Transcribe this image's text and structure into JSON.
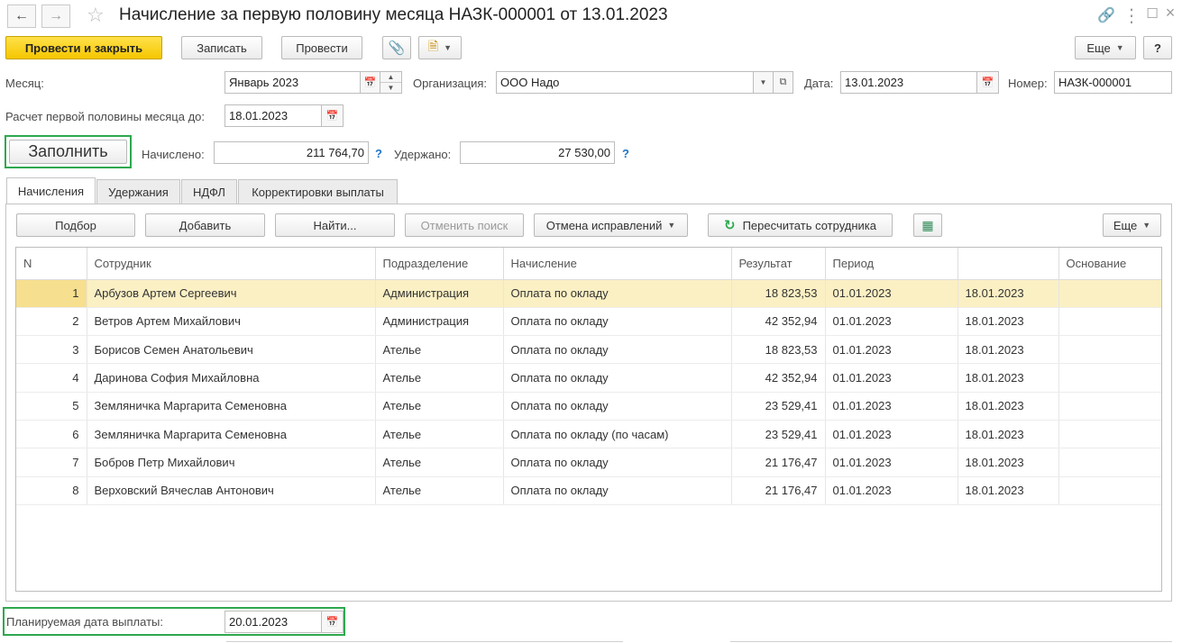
{
  "window": {
    "title": "Начисление за первую половину месяца НАЗК-000001 от 13.01.2023"
  },
  "toolbar": {
    "post_close": "Провести и закрыть",
    "save": "Записать",
    "post": "Провести",
    "more": "Еще",
    "help": "?"
  },
  "header": {
    "month_label": "Месяц:",
    "month_value": "Январь 2023",
    "org_label": "Организация:",
    "org_value": "ООО Надо",
    "date_label": "Дата:",
    "date_value": "13.01.2023",
    "number_label": "Номер:",
    "number_value": "НАЗК-000001",
    "calc_label": "Расчет первой половины месяца до:",
    "calc_value": "18.01.2023",
    "fill_button": "Заполнить",
    "accrued_label": "Начислено:",
    "accrued_value": "211 764,70",
    "withheld_label": "Удержано:",
    "withheld_value": "27 530,00",
    "help_mark": "?"
  },
  "tabs": [
    {
      "label": "Начисления",
      "active": true
    },
    {
      "label": "Удержания",
      "active": false
    },
    {
      "label": "НДФЛ",
      "active": false
    },
    {
      "label": "Корректировки выплаты",
      "active": false
    }
  ],
  "table_toolbar": {
    "pick": "Подбор",
    "add": "Добавить",
    "find": "Найти...",
    "cancel_search": "Отменить поиск",
    "cancel_fixes": "Отмена исправлений",
    "recalc": "Пересчитать сотрудника",
    "more": "Еще"
  },
  "table": {
    "columns": [
      "N",
      "Сотрудник",
      "Подразделение",
      "Начисление",
      "Результат",
      "Период",
      "",
      "Основание"
    ],
    "rows": [
      [
        "1",
        "Арбузов Артем Сергеевич",
        "Администрация",
        "Оплата по окладу",
        "18 823,53",
        "01.01.2023",
        "18.01.2023",
        ""
      ],
      [
        "2",
        "Ветров Артем Михайлович",
        "Администрация",
        "Оплата по окладу",
        "42 352,94",
        "01.01.2023",
        "18.01.2023",
        ""
      ],
      [
        "3",
        "Борисов Семен Анатольевич",
        "Ателье",
        "Оплата по окладу",
        "18 823,53",
        "01.01.2023",
        "18.01.2023",
        ""
      ],
      [
        "4",
        "Даринова София Михайловна",
        "Ателье",
        "Оплата по окладу",
        "42 352,94",
        "01.01.2023",
        "18.01.2023",
        ""
      ],
      [
        "5",
        "Земляничка Маргарита Семеновна",
        "Ателье",
        "Оплата по окладу",
        "23 529,41",
        "01.01.2023",
        "18.01.2023",
        ""
      ],
      [
        "6",
        "Земляничка Маргарита Семеновна",
        "Ателье",
        "Оплата по окладу (по часам)",
        "23 529,41",
        "01.01.2023",
        "18.01.2023",
        ""
      ],
      [
        "7",
        "Бобров Петр Михайлович",
        "Ателье",
        "Оплата по окладу",
        "21 176,47",
        "01.01.2023",
        "18.01.2023",
        ""
      ],
      [
        "8",
        "Верховский Вячеслав Антонович",
        "Ателье",
        "Оплата по окладу",
        "21 176,47",
        "01.01.2023",
        "18.01.2023",
        ""
      ]
    ]
  },
  "footer": {
    "pay_date_label": "Планируемая дата выплаты:",
    "pay_date_value": "20.01.2023"
  },
  "colors": {
    "primary_button": "#f5c600",
    "selected_row": "#fbf0c4",
    "highlight_frame": "#2ea84e",
    "help_link": "#1e73c8"
  }
}
